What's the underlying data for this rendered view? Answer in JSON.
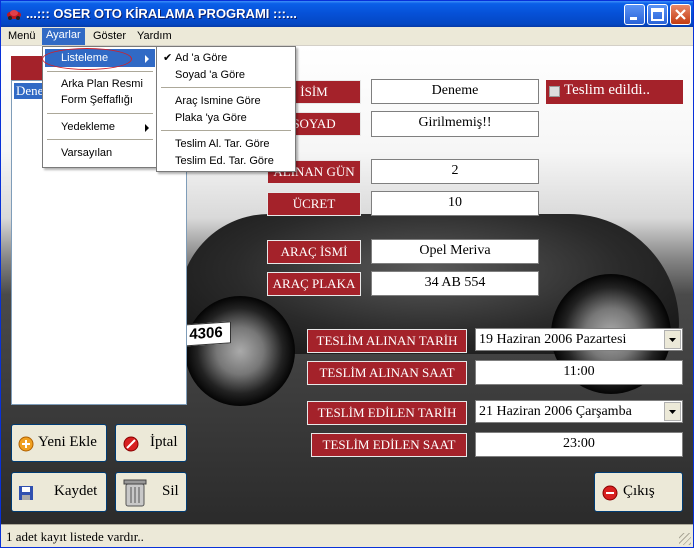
{
  "window": {
    "title": "...::: OSER OTO KİRALAMA PROGRAMI :::..."
  },
  "menubar": {
    "items": [
      "Menü",
      "Ayarlar",
      "Göster",
      "Yardım"
    ]
  },
  "ayarlar_menu": {
    "items": [
      "Listeleme",
      "Arka Plan Resmi",
      "Form Şeffaflığı",
      "Yedekleme",
      "Varsayılan"
    ]
  },
  "listeleme_submenu": {
    "items": [
      "Ad 'a Göre",
      "Soyad 'a Göre",
      "Araç Ismine Göre",
      "Plaka 'ya Göre",
      "Teslim Al. Tar. Göre",
      "Teslim Ed. Tar. Göre"
    ]
  },
  "list": {
    "items": [
      "Deneme"
    ]
  },
  "car_plate_text": "4306",
  "form": {
    "isim_label": "İSİM",
    "isim_value": "Deneme",
    "soyad_label": "SOYAD",
    "soyad_value": "Girilmemiş!!",
    "alinan_gun_label": "ALINAN GÜN",
    "alinan_gun_value": "2",
    "ucret_label": "ÜCRET",
    "ucret_value": "10",
    "arac_ismi_label": "ARAÇ İSMİ",
    "arac_ismi_value": "Opel Meriva",
    "arac_plaka_label": "ARAÇ PLAKA",
    "arac_plaka_value": "34 AB 554",
    "teslim_edildi_label": "Teslim edildi..",
    "teslim_alinan_tarih_label": "TESLİM ALINAN TARİH",
    "teslim_alinan_tarih_value": "19  Haziran  2006  Pazartesi",
    "teslim_alinan_saat_label": "TESLİM ALINAN SAAT",
    "teslim_alinan_saat_value": "11:00",
    "teslim_edilen_tarih_label": "TESLİM EDİLEN TARİH",
    "teslim_edilen_tarih_value": "21  Haziran  2006  Çarşamba",
    "teslim_edilen_saat_label": "TESLİM EDİLEN SAAT",
    "teslim_edilen_saat_value": "23:00"
  },
  "buttons": {
    "yeni_ekle": "Yeni Ekle",
    "iptal": "İptal",
    "kaydet": "Kaydet",
    "sil": "Sil",
    "cikis": "Çıkış"
  },
  "status": {
    "text": "1 adet kayıt listede vardır.."
  },
  "colors": {
    "label_red": "#a4222a",
    "selection_blue": "#316ac5",
    "annotation_red": "#d0202a"
  },
  "icons": {
    "title": "car-icon",
    "yeni_ekle": "add-circle-icon",
    "iptal": "cancel-icon",
    "kaydet": "floppy-disk-icon",
    "sil": "trash-can-icon",
    "cikis": "exit-icon"
  }
}
